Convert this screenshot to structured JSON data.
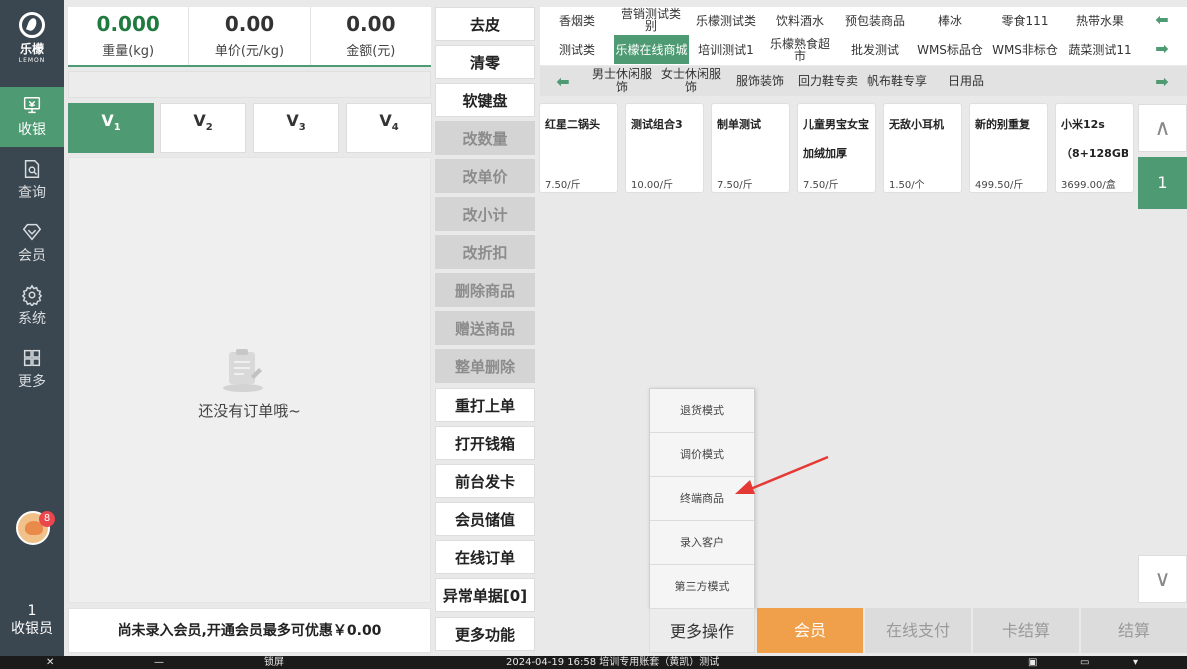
{
  "brand": {
    "name": "乐檬",
    "en": "LEMON"
  },
  "sidebar": {
    "items": [
      {
        "label": "收银",
        "icon": "cashier-icon",
        "active": true
      },
      {
        "label": "查询",
        "icon": "search-doc-icon"
      },
      {
        "label": "会员",
        "icon": "diamond-icon"
      },
      {
        "label": "系统",
        "icon": "gear-icon"
      },
      {
        "label": "更多",
        "icon": "grid-icon"
      }
    ],
    "badge": "8",
    "cashier_number": "1",
    "cashier_label": "收银员"
  },
  "stats": [
    {
      "value": "0.000",
      "label": "重量(kg)"
    },
    {
      "value": "0.00",
      "label": "单价(元/kg)"
    },
    {
      "value": "0.00",
      "label": "金额(元)"
    }
  ],
  "vtabs": [
    {
      "main": "V",
      "sub": "1"
    },
    {
      "main": "V",
      "sub": "2"
    },
    {
      "main": "V",
      "sub": "3"
    },
    {
      "main": "V",
      "sub": "4"
    }
  ],
  "order": {
    "empty_text": "还没有订单哦~"
  },
  "member_bar": "尚未录入会员,开通会员最多可优惠￥0.00",
  "actions": [
    {
      "label": "去皮",
      "enabled": true
    },
    {
      "label": "清零",
      "enabled": true
    },
    {
      "label": "软键盘",
      "enabled": true
    },
    {
      "label": "改数量",
      "enabled": false
    },
    {
      "label": "改单价",
      "enabled": false
    },
    {
      "label": "改小计",
      "enabled": false
    },
    {
      "label": "改折扣",
      "enabled": false
    },
    {
      "label": "删除商品",
      "enabled": false
    },
    {
      "label": "赠送商品",
      "enabled": false
    },
    {
      "label": "整单删除",
      "enabled": false
    },
    {
      "label": "重打上单",
      "enabled": true
    },
    {
      "label": "打开钱箱",
      "enabled": true
    },
    {
      "label": "前台发卡",
      "enabled": true
    },
    {
      "label": "会员储值",
      "enabled": true
    },
    {
      "label": "在线订单",
      "enabled": true
    },
    {
      "label": "异常单据[0]",
      "enabled": true
    },
    {
      "label": "更多功能",
      "enabled": true
    }
  ],
  "categories_row1": [
    "香烟类",
    "营销测试类别",
    "乐檬测试类",
    "饮料酒水",
    "预包装商品",
    "棒冰",
    "零食111",
    "热带水果"
  ],
  "categories_row2": [
    "测试类",
    "乐檬在线商城",
    "培训测试1",
    "乐檬熟食超市",
    "批发测试",
    "WMS标品仓",
    "WMS非标仓",
    "蔬菜测试11"
  ],
  "active_category": "乐檬在线商城",
  "subcategories": [
    "男士休闲服饰",
    "女士休闲服饰",
    "服饰装饰",
    "回力鞋专卖",
    "帆布鞋专享",
    "日用品"
  ],
  "products": [
    {
      "name": "红星二锅头",
      "price": "7.50/斤"
    },
    {
      "name": "测试组合3",
      "price": "10.00/斤"
    },
    {
      "name": "制单测试",
      "price": "7.50/斤"
    },
    {
      "name": "儿童男宝女宝加绒加厚休...",
      "price": "7.50/斤"
    },
    {
      "name": "无敌小耳机",
      "price": "1.50/个"
    },
    {
      "name": "新的别重复",
      "price": "499.50/斤"
    },
    {
      "name": "小米12s（8+128GB)",
      "price": "3699.00/盒"
    }
  ],
  "page": "1",
  "popup_menu": [
    "退货模式",
    "调价模式",
    "终端商品",
    "录入客户",
    "第三方模式"
  ],
  "bottom": {
    "more": "更多操作",
    "member": "会员",
    "online_pay": "在线支付",
    "card_settle": "卡结算",
    "settle": "结算"
  },
  "taskbar": {
    "lock": "锁屏",
    "info": "2024-04-19 16:58 培训专用账套（黄凯）测试"
  },
  "colors": {
    "accent": "#4e9a73",
    "member": "#f0a04b",
    "annotation": "#e53935"
  }
}
